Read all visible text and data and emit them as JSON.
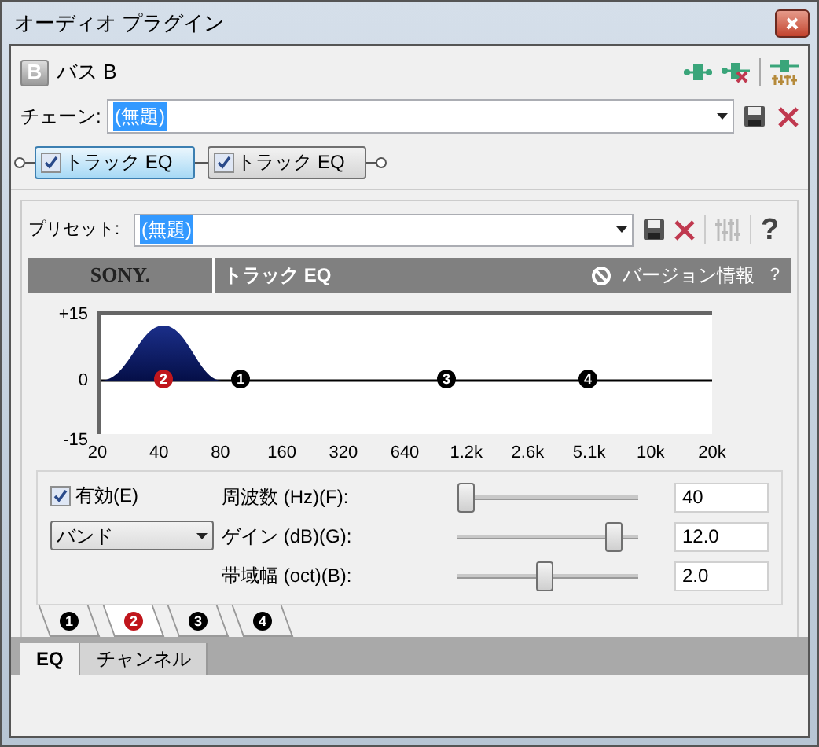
{
  "window": {
    "title": "オーディオ プラグイン"
  },
  "bus": {
    "badge": "B",
    "name": "バス B"
  },
  "chain": {
    "label": "チェーン:",
    "value": "(無題)"
  },
  "plugins": [
    {
      "label": "トラック EQ",
      "checked": true,
      "selected": true
    },
    {
      "label": "トラック EQ",
      "checked": true,
      "selected": false
    }
  ],
  "preset": {
    "label": "プリセット:",
    "value": "(無題)"
  },
  "banner": {
    "brand": "SONY.",
    "plugin": "トラック EQ",
    "about": "バージョン情報",
    "help": "?"
  },
  "graph": {
    "yticks": [
      "+15",
      "0",
      "-15"
    ],
    "xticks": [
      "20",
      "40",
      "80",
      "160",
      "320",
      "640",
      "1.2k",
      "2.6k",
      "5.1k",
      "10k",
      "20k"
    ],
    "markers": [
      {
        "label": "2",
        "selected": true
      },
      {
        "label": "1",
        "selected": false
      },
      {
        "label": "3",
        "selected": false
      },
      {
        "label": "4",
        "selected": false
      }
    ]
  },
  "band": {
    "enabled_label": "有効(E)",
    "enabled": true,
    "type": "バンド",
    "params": [
      {
        "label": "周波数 (Hz)(F):",
        "level": 0,
        "value": "40"
      },
      {
        "label": "ゲイン (dB)(G):",
        "level": 0.9,
        "value": "12.0"
      },
      {
        "label": "帯域幅 (oct)(B):",
        "level": 0.48,
        "value": "2.0"
      }
    ]
  },
  "band_tabs": [
    {
      "label": "1",
      "selected": false
    },
    {
      "label": "2",
      "selected": true
    },
    {
      "label": "3",
      "selected": false
    },
    {
      "label": "4",
      "selected": false
    }
  ],
  "bottom_tabs": [
    {
      "label": "EQ",
      "selected": true
    },
    {
      "label": "チャンネル",
      "selected": false
    }
  ]
}
